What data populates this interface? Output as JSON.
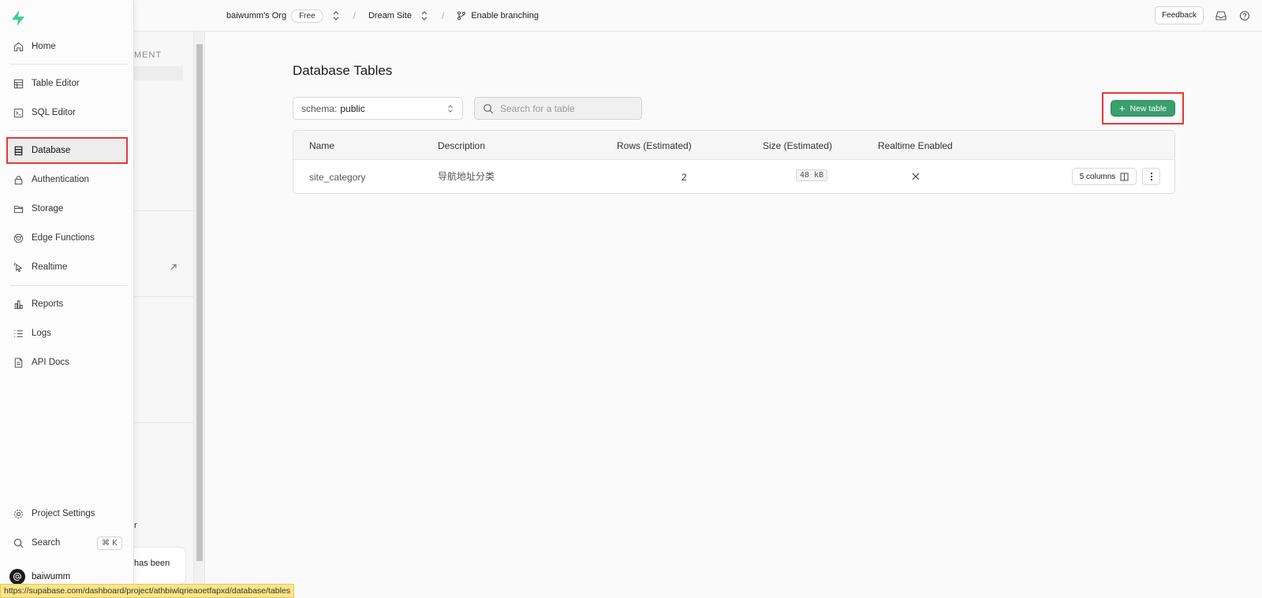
{
  "header": {
    "org_name": "baiwumm's Org",
    "plan_badge": "Free",
    "project_name": "Dream Site",
    "branching_label": "Enable branching",
    "feedback_label": "Feedback"
  },
  "submenu": {
    "section_title_fragment": "MENT",
    "text_fragment": "r",
    "toast_fragment": "has been"
  },
  "sidebar": {
    "items": [
      {
        "label": "Home",
        "icon": "home-icon"
      },
      {
        "label": "Table Editor",
        "icon": "table-icon"
      },
      {
        "label": "SQL Editor",
        "icon": "terminal-icon"
      },
      {
        "label": "Database",
        "icon": "database-icon",
        "active": true
      },
      {
        "label": "Authentication",
        "icon": "lock-icon"
      },
      {
        "label": "Storage",
        "icon": "folder-icon"
      },
      {
        "label": "Edge Functions",
        "icon": "edge-functions-icon"
      },
      {
        "label": "Realtime",
        "icon": "cursor-icon"
      },
      {
        "label": "Reports",
        "icon": "chart-icon"
      },
      {
        "label": "Logs",
        "icon": "list-icon"
      },
      {
        "label": "API Docs",
        "icon": "file-icon"
      }
    ],
    "project_settings": "Project Settings",
    "search": "Search",
    "search_shortcut": "⌘ K",
    "user_name": "baiwumm"
  },
  "main": {
    "title": "Database Tables",
    "schema_prefix": "schema:",
    "schema_value": "public",
    "search_placeholder": "Search for a table",
    "new_table_label": "New table",
    "columns": [
      "Name",
      "Description",
      "Rows (Estimated)",
      "Size (Estimated)",
      "Realtime Enabled"
    ],
    "rows": [
      {
        "name": "site_category",
        "description": "导航地址分类",
        "rows": "2",
        "size": "48 kB",
        "columns_button": "5 columns"
      }
    ]
  },
  "status_url": "https://supabase.com/dashboard/project/athbiwlqrieaoetfapxd/database/tables",
  "colors": {
    "brand_green": "#3ecf8e",
    "button_green": "#3a9e6d",
    "highlight_red": "#e53935",
    "status_yellow": "#fbe58a"
  }
}
